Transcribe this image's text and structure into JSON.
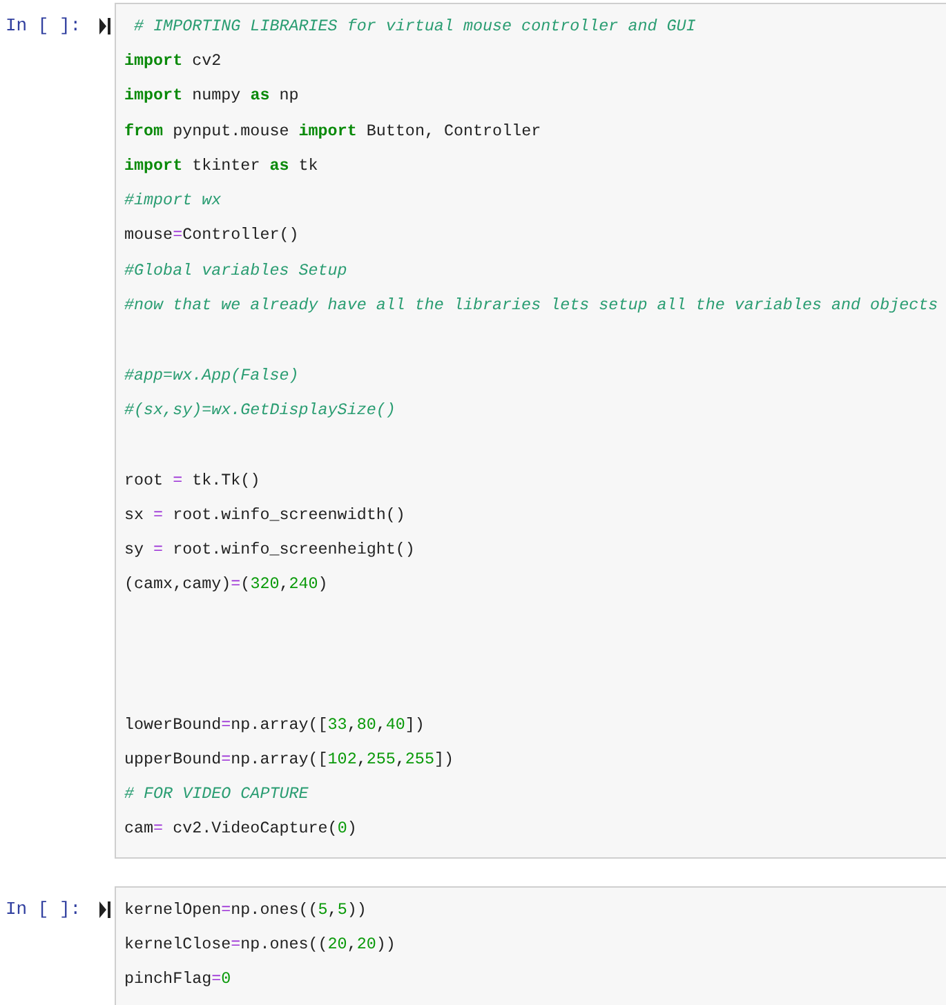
{
  "cells": [
    {
      "prompt": "In [ ]:",
      "lines": [
        {
          "kind": "code",
          "tokens": [
            {
              "text": " # IMPORTING LIBRARIES for virtual mouse controller and GUI",
              "kind": "comment"
            }
          ]
        },
        {
          "kind": "code",
          "tokens": [
            {
              "text": "import",
              "kind": "keyword"
            },
            {
              "text": " cv2",
              "kind": "plain"
            }
          ]
        },
        {
          "kind": "code",
          "tokens": [
            {
              "text": "import",
              "kind": "keyword"
            },
            {
              "text": " numpy ",
              "kind": "plain"
            },
            {
              "text": "as",
              "kind": "keyword"
            },
            {
              "text": " np",
              "kind": "plain"
            }
          ]
        },
        {
          "kind": "code",
          "tokens": [
            {
              "text": "from",
              "kind": "keyword"
            },
            {
              "text": " pynput.mouse ",
              "kind": "plain"
            },
            {
              "text": "import",
              "kind": "keyword"
            },
            {
              "text": " Button, Controller",
              "kind": "plain"
            }
          ]
        },
        {
          "kind": "code",
          "tokens": [
            {
              "text": "import",
              "kind": "keyword"
            },
            {
              "text": " tkinter ",
              "kind": "plain"
            },
            {
              "text": "as",
              "kind": "keyword"
            },
            {
              "text": " tk",
              "kind": "plain"
            }
          ]
        },
        {
          "kind": "code",
          "tokens": [
            {
              "text": "#import wx",
              "kind": "comment"
            }
          ]
        },
        {
          "kind": "code",
          "tokens": [
            {
              "text": "mouse",
              "kind": "plain"
            },
            {
              "text": "=",
              "kind": "operator"
            },
            {
              "text": "Controller()",
              "kind": "plain"
            }
          ]
        },
        {
          "kind": "code",
          "tokens": [
            {
              "text": "#Global variables Setup",
              "kind": "comment"
            }
          ]
        },
        {
          "kind": "code",
          "tokens": [
            {
              "text": "#now that we already have all the libraries lets setup all the variables and objects",
              "kind": "comment"
            }
          ]
        },
        {
          "kind": "blank"
        },
        {
          "kind": "code",
          "tokens": [
            {
              "text": "#app=wx.App(False)",
              "kind": "comment"
            }
          ]
        },
        {
          "kind": "code",
          "tokens": [
            {
              "text": "#(sx,sy)=wx.GetDisplaySize()",
              "kind": "comment"
            }
          ]
        },
        {
          "kind": "blank"
        },
        {
          "kind": "code",
          "tokens": [
            {
              "text": "root ",
              "kind": "plain"
            },
            {
              "text": "=",
              "kind": "operator"
            },
            {
              "text": " tk.Tk()",
              "kind": "plain"
            }
          ]
        },
        {
          "kind": "code",
          "tokens": [
            {
              "text": "sx ",
              "kind": "plain"
            },
            {
              "text": "=",
              "kind": "operator"
            },
            {
              "text": " root.winfo_screenwidth()",
              "kind": "plain"
            }
          ]
        },
        {
          "kind": "code",
          "tokens": [
            {
              "text": "sy ",
              "kind": "plain"
            },
            {
              "text": "=",
              "kind": "operator"
            },
            {
              "text": " root.winfo_screenheight()",
              "kind": "plain"
            }
          ]
        },
        {
          "kind": "code",
          "tokens": [
            {
              "text": "(camx,camy)",
              "kind": "plain"
            },
            {
              "text": "=",
              "kind": "operator"
            },
            {
              "text": "(",
              "kind": "plain"
            },
            {
              "text": "320",
              "kind": "number"
            },
            {
              "text": ",",
              "kind": "plain"
            },
            {
              "text": "240",
              "kind": "number"
            },
            {
              "text": ")",
              "kind": "plain"
            }
          ]
        },
        {
          "kind": "blank"
        },
        {
          "kind": "blank"
        },
        {
          "kind": "blank"
        },
        {
          "kind": "code",
          "tokens": [
            {
              "text": "lowerBound",
              "kind": "plain"
            },
            {
              "text": "=",
              "kind": "operator"
            },
            {
              "text": "np.array([",
              "kind": "plain"
            },
            {
              "text": "33",
              "kind": "number"
            },
            {
              "text": ",",
              "kind": "plain"
            },
            {
              "text": "80",
              "kind": "number"
            },
            {
              "text": ",",
              "kind": "plain"
            },
            {
              "text": "40",
              "kind": "number"
            },
            {
              "text": "])",
              "kind": "plain"
            }
          ]
        },
        {
          "kind": "code",
          "tokens": [
            {
              "text": "upperBound",
              "kind": "plain"
            },
            {
              "text": "=",
              "kind": "operator"
            },
            {
              "text": "np.array([",
              "kind": "plain"
            },
            {
              "text": "102",
              "kind": "number"
            },
            {
              "text": ",",
              "kind": "plain"
            },
            {
              "text": "255",
              "kind": "number"
            },
            {
              "text": ",",
              "kind": "plain"
            },
            {
              "text": "255",
              "kind": "number"
            },
            {
              "text": "])",
              "kind": "plain"
            }
          ]
        },
        {
          "kind": "code",
          "tokens": [
            {
              "text": "# FOR VIDEO CAPTURE",
              "kind": "comment"
            }
          ]
        },
        {
          "kind": "code",
          "tokens": [
            {
              "text": "cam",
              "kind": "plain"
            },
            {
              "text": "=",
              "kind": "operator"
            },
            {
              "text": " cv2.VideoCapture(",
              "kind": "plain"
            },
            {
              "text": "0",
              "kind": "number"
            },
            {
              "text": ")",
              "kind": "plain"
            }
          ]
        }
      ]
    },
    {
      "prompt": "In [ ]:",
      "lines": [
        {
          "kind": "code",
          "tokens": [
            {
              "text": "kernelOpen",
              "kind": "plain"
            },
            {
              "text": "=",
              "kind": "operator"
            },
            {
              "text": "np.ones((",
              "kind": "plain"
            },
            {
              "text": "5",
              "kind": "number"
            },
            {
              "text": ",",
              "kind": "plain"
            },
            {
              "text": "5",
              "kind": "number"
            },
            {
              "text": "))",
              "kind": "plain"
            }
          ]
        },
        {
          "kind": "code",
          "tokens": [
            {
              "text": "kernelClose",
              "kind": "plain"
            },
            {
              "text": "=",
              "kind": "operator"
            },
            {
              "text": "np.ones((",
              "kind": "plain"
            },
            {
              "text": "20",
              "kind": "number"
            },
            {
              "text": ",",
              "kind": "plain"
            },
            {
              "text": "20",
              "kind": "number"
            },
            {
              "text": "))",
              "kind": "plain"
            }
          ]
        },
        {
          "kind": "code",
          "tokens": [
            {
              "text": "pinchFlag",
              "kind": "plain"
            },
            {
              "text": "=",
              "kind": "operator"
            },
            {
              "text": "0",
              "kind": "number"
            }
          ]
        }
      ]
    }
  ]
}
